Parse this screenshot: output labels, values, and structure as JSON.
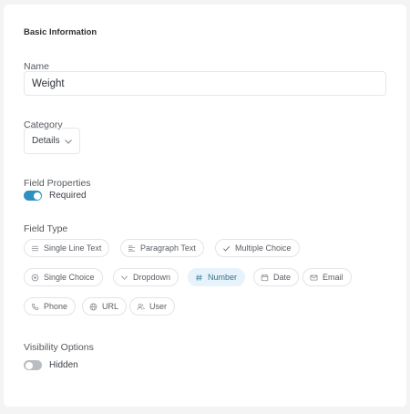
{
  "section_title": "Basic Information",
  "name": {
    "label": "Name",
    "value": "Weight"
  },
  "category": {
    "label": "Category",
    "value": "Details"
  },
  "field_properties": {
    "label": "Field Properties",
    "required_label": "Required",
    "required_on": true
  },
  "field_type": {
    "label": "Field Type",
    "selected": "Number",
    "options": [
      {
        "label": "Single Line Text",
        "icon": "lines-icon"
      },
      {
        "label": "Paragraph Text",
        "icon": "paragraph-icon"
      },
      {
        "label": "Multiple Choice",
        "icon": "check-icon"
      },
      {
        "label": "Single Choice",
        "icon": "radio-icon"
      },
      {
        "label": "Dropdown",
        "icon": "chevron-down-icon"
      },
      {
        "label": "Number",
        "icon": "hash-icon"
      },
      {
        "label": "Date",
        "icon": "calendar-icon"
      },
      {
        "label": "Email",
        "icon": "mail-icon"
      },
      {
        "label": "Phone",
        "icon": "phone-icon"
      },
      {
        "label": "URL",
        "icon": "globe-icon"
      },
      {
        "label": "User",
        "icon": "users-icon"
      }
    ]
  },
  "visibility": {
    "label": "Visibility Options",
    "hidden_label": "Hidden",
    "hidden_on": false
  },
  "colors": {
    "accent": "#2e8fc0",
    "selected_chip_bg": "#e6f3fa"
  }
}
